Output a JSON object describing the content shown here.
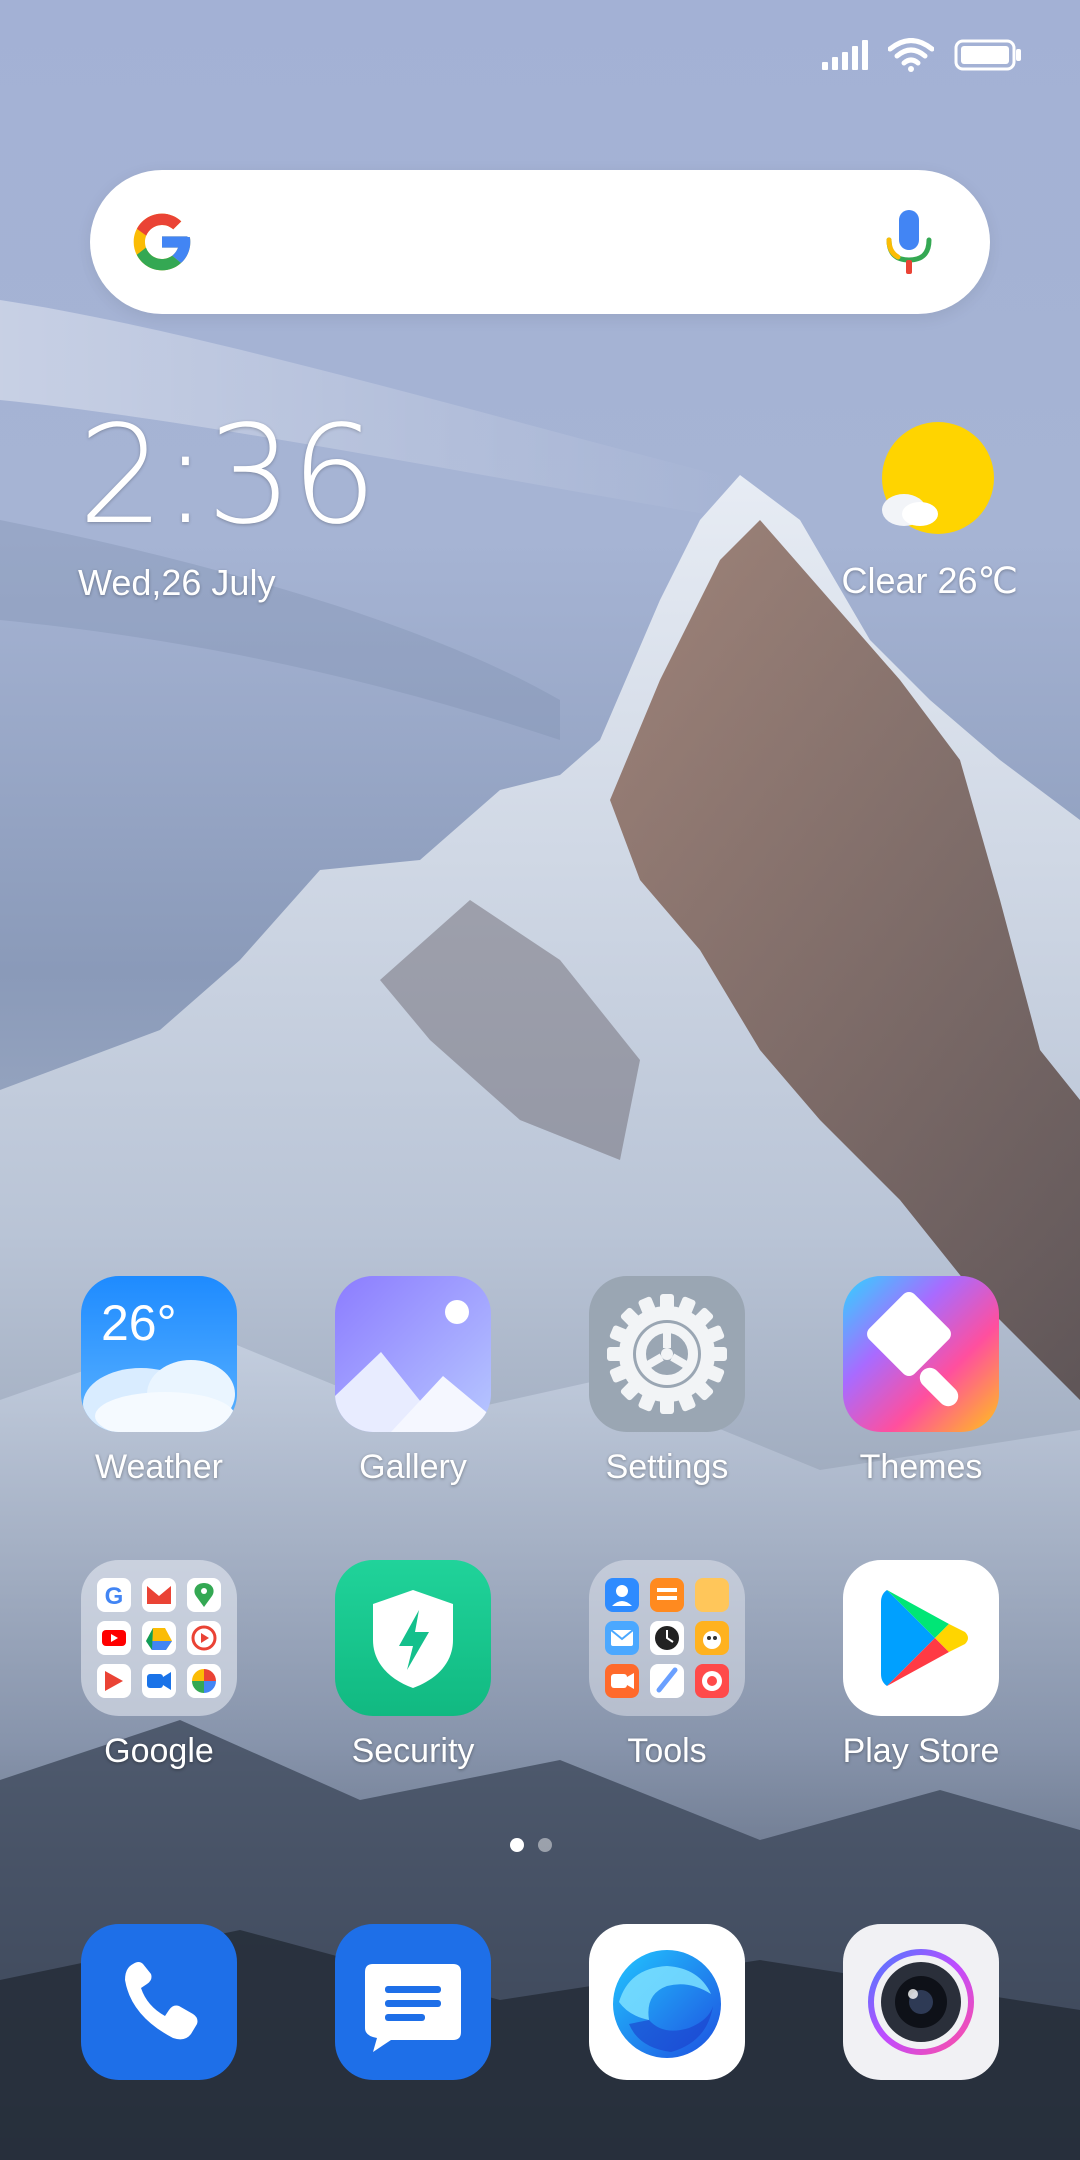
{
  "status_bar": {
    "icons": [
      "cellular-signal-icon",
      "wifi-icon",
      "battery-icon"
    ]
  },
  "search": {
    "placeholder": "",
    "icons": [
      "google-g-icon",
      "mic-icon"
    ]
  },
  "clock_widget": {
    "time": "2:36",
    "date": "Wed,26 July"
  },
  "weather_widget": {
    "condition": "Clear 26℃",
    "icon": "sun-cloud-icon"
  },
  "apps": [
    {
      "label": "Weather",
      "icon": "weather-icon",
      "icon_text": "26°"
    },
    {
      "label": "Gallery",
      "icon": "gallery-icon"
    },
    {
      "label": "Settings",
      "icon": "settings-gear-icon"
    },
    {
      "label": "Themes",
      "icon": "themes-brush-icon"
    },
    {
      "label": "Google",
      "icon": "google-folder-icon"
    },
    {
      "label": "Security",
      "icon": "security-shield-icon"
    },
    {
      "label": "Tools",
      "icon": "tools-folder-icon"
    },
    {
      "label": "Play Store",
      "icon": "play-store-icon"
    }
  ],
  "pager": {
    "pages": 2,
    "active": 1
  },
  "dock": [
    {
      "name": "Phone",
      "icon": "phone-icon"
    },
    {
      "name": "Messages",
      "icon": "messages-icon"
    },
    {
      "name": "Browser",
      "icon": "browser-icon"
    },
    {
      "name": "Camera",
      "icon": "camera-icon"
    }
  ],
  "colors": {
    "sky_top": "#A5B3D6",
    "google_blue": "#4285F4",
    "google_red": "#EA4335",
    "google_yellow": "#FBBC05",
    "google_green": "#34A853",
    "weather_sun": "#FFD400",
    "dock_blue": "#1E6FE8"
  }
}
